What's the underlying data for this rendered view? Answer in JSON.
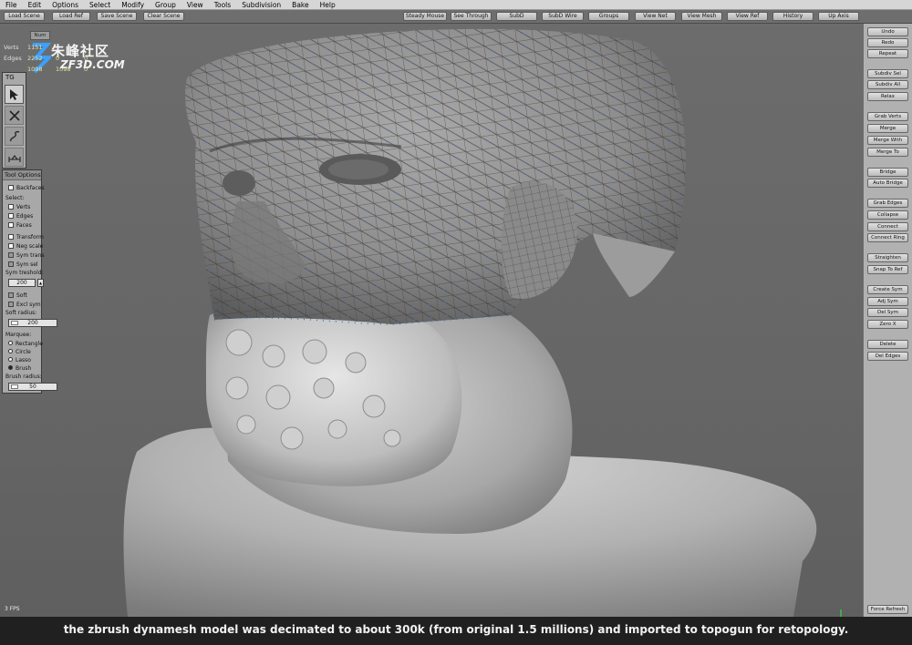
{
  "menu": [
    "File",
    "Edit",
    "Options",
    "Select",
    "Modify",
    "Group",
    "View",
    "Tools",
    "Subdivision",
    "Bake",
    "Help"
  ],
  "toolbar_left": [
    "Load Scene",
    "Load Ref",
    "Save Scene",
    "Clear Scene"
  ],
  "toolbar_right": [
    "Steady Mouse",
    "See Through",
    "SubD",
    "SubD Wire",
    "Groups",
    "View Net",
    "View Mesh",
    "View Ref",
    "History",
    "Up Axis"
  ],
  "stats": {
    "header": "Num",
    "verts_label": "Verts",
    "verts_values": [
      "1151",
      "",
      ""
    ],
    "edges_label": "Edges",
    "edges_values": [
      "2252",
      "0",
      "0"
    ],
    "faces_label": "",
    "faces_values": [
      "1098",
      "1098",
      "0"
    ]
  },
  "watermark": {
    "cn": "朱峰社区",
    "en": "ZF3D.COM"
  },
  "tg": {
    "title": "TG",
    "tools": [
      "select-tool-icon",
      "move-tool-icon",
      "draw-tool-icon",
      "measure-tool-icon"
    ]
  },
  "tool_options": {
    "title": "Tool Options",
    "backfaces": "Backfaces",
    "select_label": "Select:",
    "verts": "Verts",
    "edges": "Edges",
    "faces": "Faces",
    "transform": "Transform",
    "neg_scale": "Neg scale",
    "sym_trans": "Sym trans",
    "sym_sel": "Sym sel",
    "sym_threshold_label": "Sym treshold:",
    "sym_threshold": "200",
    "soft": "Soft",
    "excl_sym": "Excl sym",
    "soft_radius_label": "Soft radius:",
    "soft_radius": "200",
    "marquee_label": "Marquee:",
    "rectangle": "Rectangle",
    "circle": "Circle",
    "lasso": "Lasso",
    "brush": "Brush",
    "brush_radius_label": "Brush radius:",
    "brush_radius": "50"
  },
  "fps": "3 FPS",
  "right_panel": {
    "undo": "Undo",
    "redo": "Redo",
    "repeat": "Repeat",
    "subdiv_sel": "Subdiv Sel",
    "subdiv_all": "Subdiv All",
    "relax": "Relax",
    "grab_verts": "Grab Verts",
    "merge": "Merge",
    "merge_with": "Merge With",
    "merge_to": "Merge To",
    "bridge": "Bridge",
    "auto_bridge": "Auto Bridge",
    "grab_edges": "Grab Edges",
    "collapse": "Collapse",
    "connect": "Connect",
    "connect_ring": "Connect Ring",
    "straighten": "Straighten",
    "snap_to_ref": "Snap To Ref",
    "create_sym": "Create Sym",
    "adj_sym": "Adj Sym",
    "del_sym": "Del Sym",
    "zero_x": "Zero X",
    "delete": "Delete",
    "del_edges": "Del Edges",
    "force_refresh": "Force Refresh"
  },
  "caption": "the zbrush dynamesh model was decimated to about 300k (from original 1.5 millions) and imported to topogun for retopology.",
  "colors": {
    "viewport": "#666666",
    "panel": "#b1b1b1",
    "stats_text": "#e8e3a8",
    "wire": "#3b74c4"
  }
}
